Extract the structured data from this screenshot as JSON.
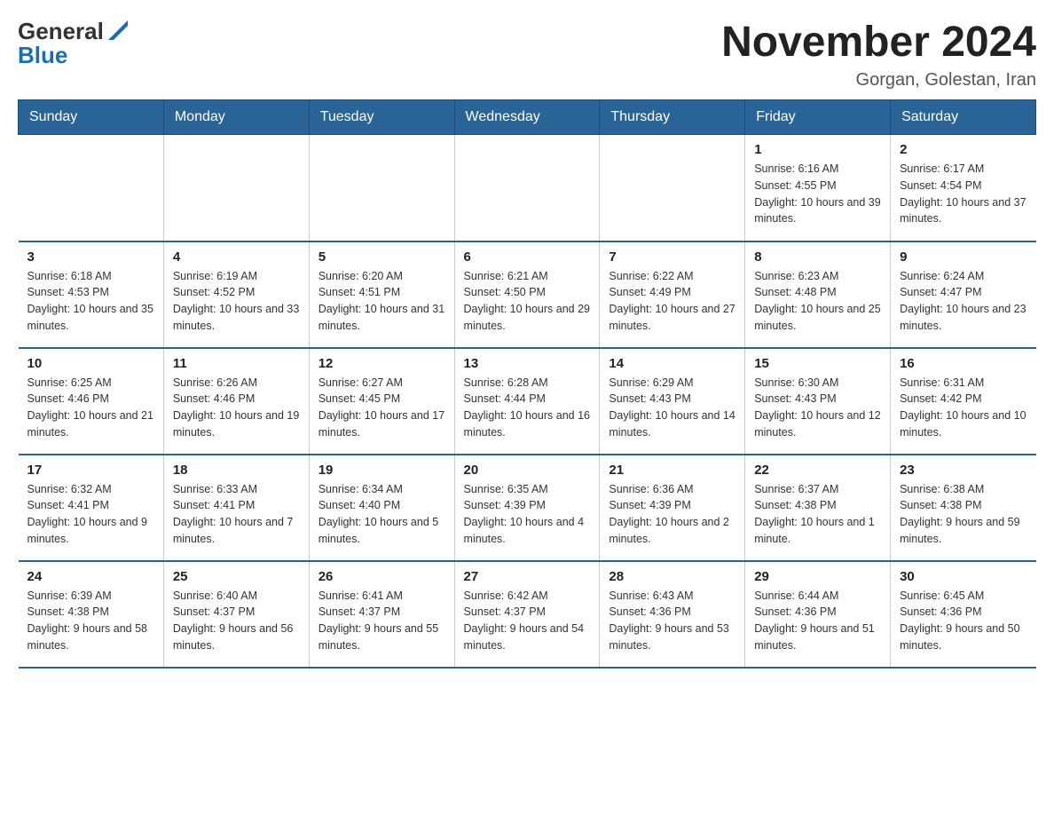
{
  "header": {
    "logo_general": "General",
    "logo_blue": "Blue",
    "calendar_title": "November 2024",
    "calendar_subtitle": "Gorgan, Golestan, Iran"
  },
  "weekdays": [
    "Sunday",
    "Monday",
    "Tuesday",
    "Wednesday",
    "Thursday",
    "Friday",
    "Saturday"
  ],
  "weeks": [
    [
      {
        "day": "",
        "info": ""
      },
      {
        "day": "",
        "info": ""
      },
      {
        "day": "",
        "info": ""
      },
      {
        "day": "",
        "info": ""
      },
      {
        "day": "",
        "info": ""
      },
      {
        "day": "1",
        "info": "Sunrise: 6:16 AM\nSunset: 4:55 PM\nDaylight: 10 hours and 39 minutes."
      },
      {
        "day": "2",
        "info": "Sunrise: 6:17 AM\nSunset: 4:54 PM\nDaylight: 10 hours and 37 minutes."
      }
    ],
    [
      {
        "day": "3",
        "info": "Sunrise: 6:18 AM\nSunset: 4:53 PM\nDaylight: 10 hours and 35 minutes."
      },
      {
        "day": "4",
        "info": "Sunrise: 6:19 AM\nSunset: 4:52 PM\nDaylight: 10 hours and 33 minutes."
      },
      {
        "day": "5",
        "info": "Sunrise: 6:20 AM\nSunset: 4:51 PM\nDaylight: 10 hours and 31 minutes."
      },
      {
        "day": "6",
        "info": "Sunrise: 6:21 AM\nSunset: 4:50 PM\nDaylight: 10 hours and 29 minutes."
      },
      {
        "day": "7",
        "info": "Sunrise: 6:22 AM\nSunset: 4:49 PM\nDaylight: 10 hours and 27 minutes."
      },
      {
        "day": "8",
        "info": "Sunrise: 6:23 AM\nSunset: 4:48 PM\nDaylight: 10 hours and 25 minutes."
      },
      {
        "day": "9",
        "info": "Sunrise: 6:24 AM\nSunset: 4:47 PM\nDaylight: 10 hours and 23 minutes."
      }
    ],
    [
      {
        "day": "10",
        "info": "Sunrise: 6:25 AM\nSunset: 4:46 PM\nDaylight: 10 hours and 21 minutes."
      },
      {
        "day": "11",
        "info": "Sunrise: 6:26 AM\nSunset: 4:46 PM\nDaylight: 10 hours and 19 minutes."
      },
      {
        "day": "12",
        "info": "Sunrise: 6:27 AM\nSunset: 4:45 PM\nDaylight: 10 hours and 17 minutes."
      },
      {
        "day": "13",
        "info": "Sunrise: 6:28 AM\nSunset: 4:44 PM\nDaylight: 10 hours and 16 minutes."
      },
      {
        "day": "14",
        "info": "Sunrise: 6:29 AM\nSunset: 4:43 PM\nDaylight: 10 hours and 14 minutes."
      },
      {
        "day": "15",
        "info": "Sunrise: 6:30 AM\nSunset: 4:43 PM\nDaylight: 10 hours and 12 minutes."
      },
      {
        "day": "16",
        "info": "Sunrise: 6:31 AM\nSunset: 4:42 PM\nDaylight: 10 hours and 10 minutes."
      }
    ],
    [
      {
        "day": "17",
        "info": "Sunrise: 6:32 AM\nSunset: 4:41 PM\nDaylight: 10 hours and 9 minutes."
      },
      {
        "day": "18",
        "info": "Sunrise: 6:33 AM\nSunset: 4:41 PM\nDaylight: 10 hours and 7 minutes."
      },
      {
        "day": "19",
        "info": "Sunrise: 6:34 AM\nSunset: 4:40 PM\nDaylight: 10 hours and 5 minutes."
      },
      {
        "day": "20",
        "info": "Sunrise: 6:35 AM\nSunset: 4:39 PM\nDaylight: 10 hours and 4 minutes."
      },
      {
        "day": "21",
        "info": "Sunrise: 6:36 AM\nSunset: 4:39 PM\nDaylight: 10 hours and 2 minutes."
      },
      {
        "day": "22",
        "info": "Sunrise: 6:37 AM\nSunset: 4:38 PM\nDaylight: 10 hours and 1 minute."
      },
      {
        "day": "23",
        "info": "Sunrise: 6:38 AM\nSunset: 4:38 PM\nDaylight: 9 hours and 59 minutes."
      }
    ],
    [
      {
        "day": "24",
        "info": "Sunrise: 6:39 AM\nSunset: 4:38 PM\nDaylight: 9 hours and 58 minutes."
      },
      {
        "day": "25",
        "info": "Sunrise: 6:40 AM\nSunset: 4:37 PM\nDaylight: 9 hours and 56 minutes."
      },
      {
        "day": "26",
        "info": "Sunrise: 6:41 AM\nSunset: 4:37 PM\nDaylight: 9 hours and 55 minutes."
      },
      {
        "day": "27",
        "info": "Sunrise: 6:42 AM\nSunset: 4:37 PM\nDaylight: 9 hours and 54 minutes."
      },
      {
        "day": "28",
        "info": "Sunrise: 6:43 AM\nSunset: 4:36 PM\nDaylight: 9 hours and 53 minutes."
      },
      {
        "day": "29",
        "info": "Sunrise: 6:44 AM\nSunset: 4:36 PM\nDaylight: 9 hours and 51 minutes."
      },
      {
        "day": "30",
        "info": "Sunrise: 6:45 AM\nSunset: 4:36 PM\nDaylight: 9 hours and 50 minutes."
      }
    ]
  ]
}
